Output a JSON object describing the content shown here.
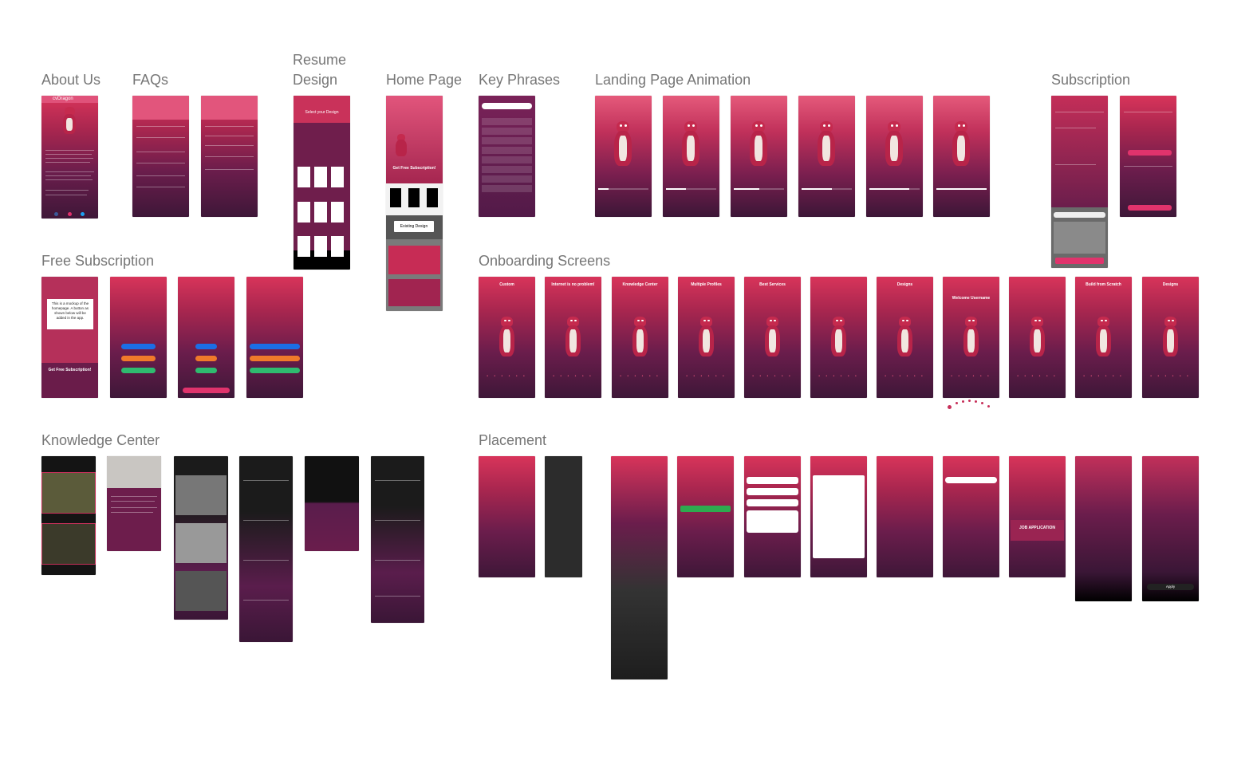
{
  "sections": {
    "about_us": "About Us",
    "faqs": "FAQs",
    "resume_design_1": "Resume",
    "resume_design_2": "Design",
    "home_page": "Home Page",
    "key_phrases": "Key Phrases",
    "landing_page_animation": "Landing Page Animation",
    "subscription": "Subscription",
    "free_subscription": "Free Subscription",
    "onboarding_screens": "Onboarding Screens",
    "knowledge_center": "Knowledge Center",
    "placement": "Placement"
  },
  "about": {
    "brand": "cvDragon"
  },
  "home": {
    "existing_design": "Existing Design",
    "free_sub": "Get Free Subscription!"
  },
  "resume": {
    "select": "Select your Design"
  },
  "landing": {
    "progress": [
      0.2,
      0.4,
      0.5,
      0.6,
      0.8,
      1.0
    ]
  },
  "free_sub": {
    "mockup_note": "This is a mockup of the homepage. A button as shown below will be added in the app.",
    "get_free": "Get Free Subscription!"
  },
  "onboarding": {
    "titles": [
      "Custom",
      "Internet is no problem!",
      "Knowledge Center",
      "Multiple Profiles",
      "Best Services",
      "",
      "Designs",
      "Welcome Username",
      "",
      "Build from Scratch",
      "Designs"
    ]
  },
  "placement": {
    "job_application": "JOB APPLICATION",
    "apply": "Apply"
  },
  "colors": {
    "accent": "#d8345a",
    "dark": "#141414",
    "label": "#767676"
  }
}
